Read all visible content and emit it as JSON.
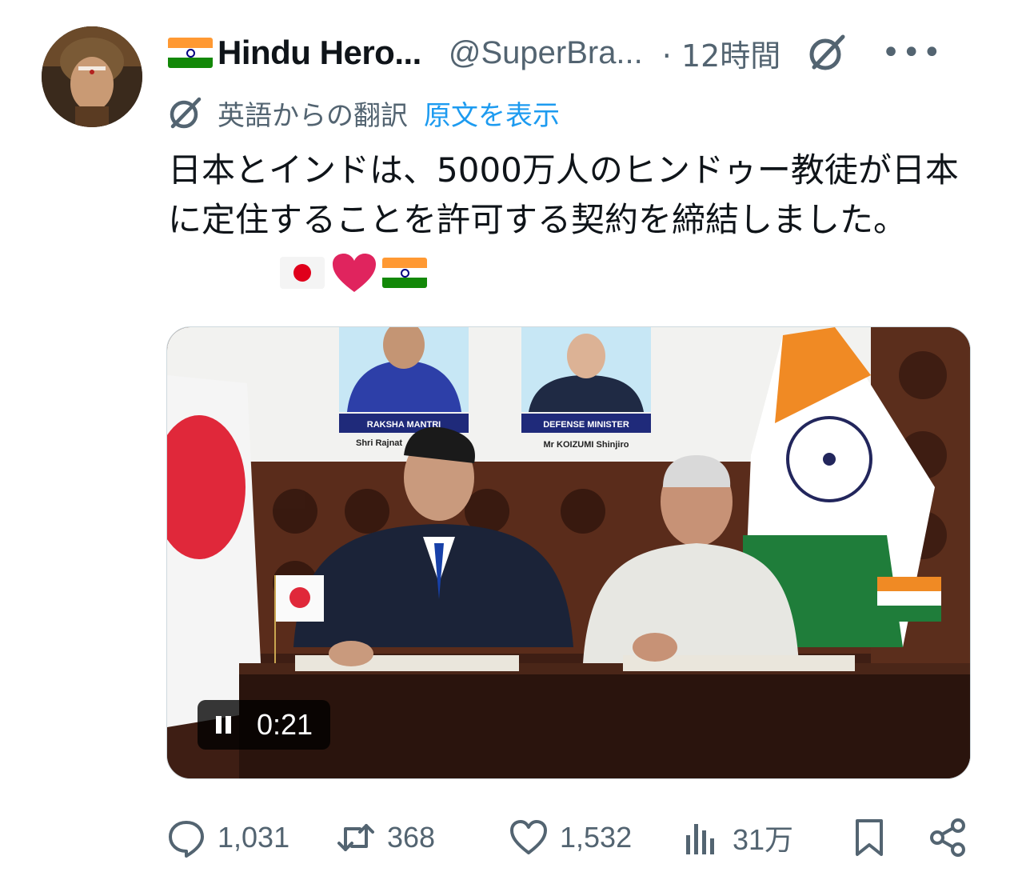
{
  "author": {
    "flag_icon": "india-flag",
    "display_name": "Hindu Hero...",
    "handle": "@SuperBra...",
    "time": "· 12時間",
    "grok_icon": "grok-icon",
    "more_icon": "more-icon",
    "more_label": "•••"
  },
  "translation": {
    "icon": "grok-icon",
    "label": "英語からの翻訳",
    "show_original": "原文を表示"
  },
  "tweet": {
    "text": "日本とインドは、5000万人のヒンドゥー教徒が日本に定住することを許可する契約を締結しました。",
    "emojis": [
      "japan-flag",
      "red-heart",
      "india-flag"
    ]
  },
  "media": {
    "left_nameplate_title": "RAKSHA MANTRI",
    "left_nameplate_name": "Shri Rajnat",
    "right_nameplate_title": "DEFENSE MINISTER",
    "right_nameplate_name": "Mr KOIZUMI Shinjiro",
    "player_time": "0:21"
  },
  "actions": {
    "replies": "1,031",
    "reposts": "368",
    "likes": "1,532",
    "views": "31万"
  },
  "colors": {
    "text_primary": "#0f1419",
    "text_secondary": "#536471",
    "link": "#1d9bf0",
    "heart": "#e0245e"
  }
}
